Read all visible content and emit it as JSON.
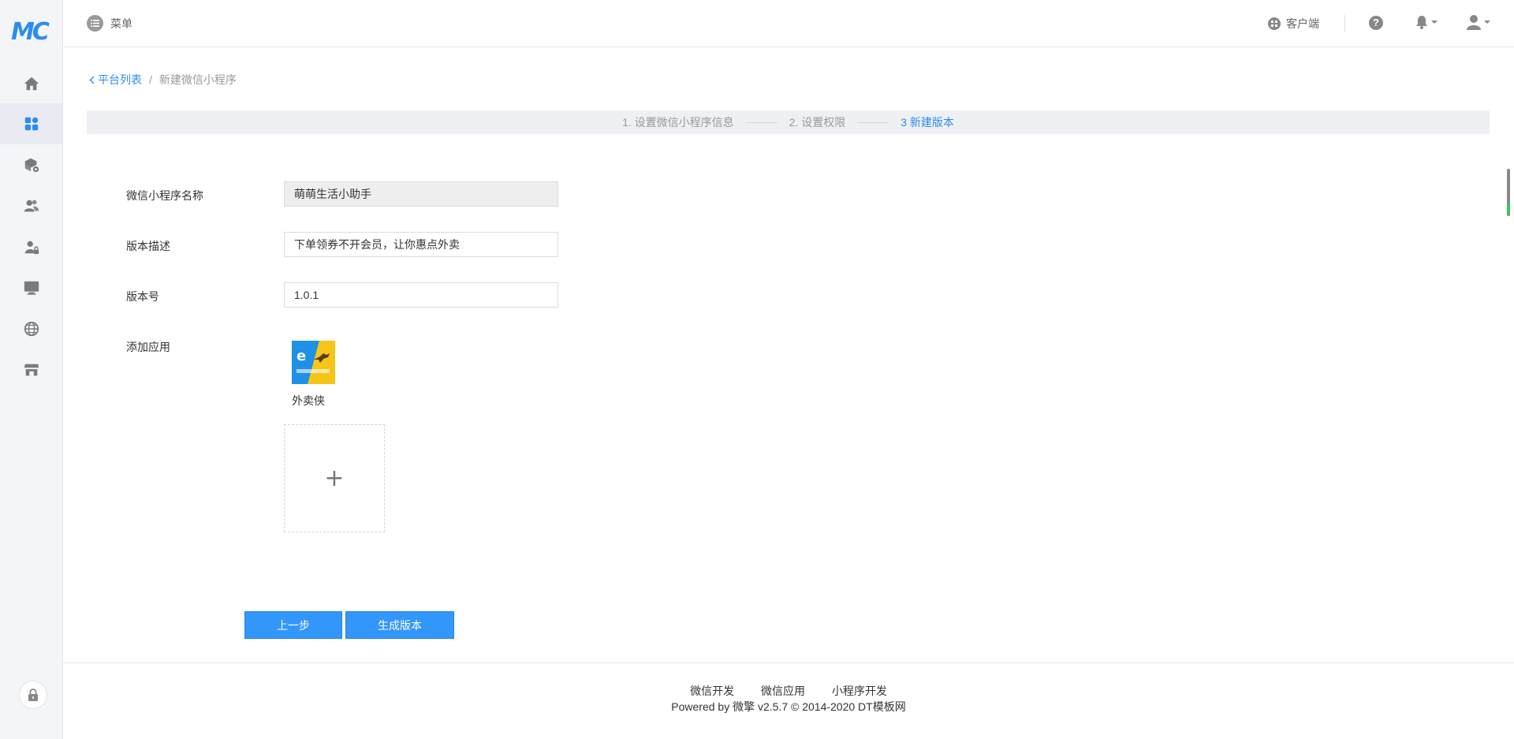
{
  "brand": {
    "logo_text": "MC"
  },
  "sidebar": {
    "items": [
      {
        "icon": "home-icon"
      },
      {
        "icon": "apps-icon",
        "active": true
      },
      {
        "icon": "box-settings-icon"
      },
      {
        "icon": "users-icon"
      },
      {
        "icon": "user-lock-icon"
      },
      {
        "icon": "monitor-icon"
      },
      {
        "icon": "globe-icon"
      },
      {
        "icon": "store-icon"
      }
    ],
    "lock_icon": "lock-icon"
  },
  "header": {
    "menu_label": "菜单",
    "client_label": "客户端"
  },
  "breadcrumb": {
    "back_label": "平台列表",
    "separator": "/",
    "current": "新建微信小程序"
  },
  "steps": [
    {
      "label": "1. 设置微信小程序信息",
      "current": false
    },
    {
      "label": "2. 设置权限",
      "current": false
    },
    {
      "label": "3 新建版本",
      "current": true
    }
  ],
  "form": {
    "name_label": "微信小程序名称",
    "name_value": "萌萌生活小助手",
    "desc_label": "版本描述",
    "desc_value": "下单领券不开会员，让你惠点外卖",
    "version_label": "版本号",
    "version_value": "1.0.1",
    "apps_label": "添加应用",
    "app_name": "外卖侠",
    "add_symbol": "+"
  },
  "buttons": {
    "prev": "上一步",
    "generate": "生成版本"
  },
  "footer": {
    "links": [
      "微信开发",
      "微信应用",
      "小程序开发"
    ],
    "copyright": "Powered by 微擎 v2.5.7 © 2014-2020 DT模板网"
  },
  "colors": {
    "accent": "#2d8cf0",
    "button": "#3296fa",
    "sidebar_bg": "#f4f5f9"
  }
}
